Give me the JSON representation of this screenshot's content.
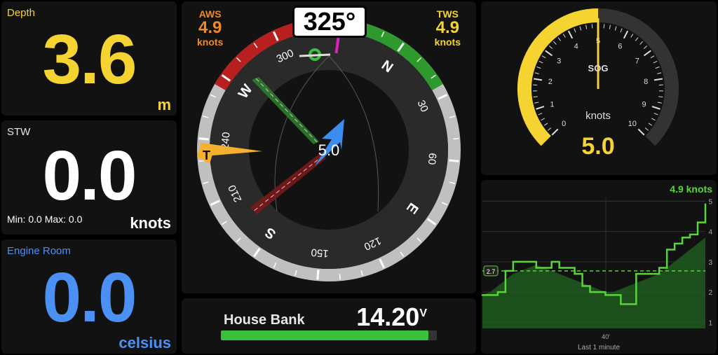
{
  "depth": {
    "title": "Depth",
    "value": "3.6",
    "unit": "m",
    "color": "#f5d331"
  },
  "stw": {
    "title": "STW",
    "value": "0.0",
    "unit": "knots",
    "minmax": "Min: 0.0 Max: 0.0",
    "color": "#ffffff"
  },
  "engine": {
    "title": "Engine Room",
    "value": "0.0",
    "unit": "celsius",
    "color": "#4a90f5"
  },
  "wind": {
    "heading": "325°",
    "aws_label": "AWS",
    "aws_value": "4.9",
    "aws_unit": "knots",
    "tws_label": "TWS",
    "tws_value": "4.9",
    "tws_unit": "knots",
    "center_value": "5.0",
    "cardinals": [
      "N",
      "E",
      "S",
      "W"
    ],
    "degree_labels": [
      "30",
      "60",
      "120",
      "150",
      "210",
      "240",
      "300"
    ],
    "true_wind_marker": "T",
    "colors": {
      "aws": "#f08a24",
      "tws": "#f5d331",
      "port": "#b82020",
      "starboard": "#2e9a2e",
      "boat": "#3d8df0"
    }
  },
  "sog": {
    "label": "SOG",
    "unit": "knots",
    "value": "5.0",
    "scale": [
      "0",
      "1",
      "2",
      "3",
      "4",
      "5",
      "6",
      "7",
      "8",
      "9",
      "10"
    ],
    "fraction": 0.5,
    "color": "#f5d331"
  },
  "housebank": {
    "title": "House Bank",
    "value": "14.20",
    "unit": "V",
    "fraction": 0.96,
    "color": "#3bc03b"
  },
  "chart_data": {
    "type": "line",
    "title": "4.9 knots",
    "xlabel": "Last 1 minute",
    "x_tick": "40'",
    "y_ticks": [
      "1",
      "2",
      "3",
      "4",
      "5"
    ],
    "ylim": [
      0.8,
      5.1
    ],
    "reference_label": "2.7",
    "reference_value": 2.7,
    "series": [
      {
        "color": "#5ad43c",
        "values": [
          1.9,
          1.9,
          2.0,
          2.7,
          3.0,
          3.0,
          3.0,
          2.8,
          2.8,
          3.0,
          2.8,
          2.8,
          2.6,
          2.2,
          2.0,
          2.0,
          1.9,
          1.9,
          1.6,
          1.6,
          2.6,
          2.6,
          2.6,
          2.8,
          3.4,
          3.6,
          3.8,
          3.9,
          4.3,
          4.9
        ]
      },
      {
        "values": [
          1.9,
          2.0,
          2.2,
          2.4,
          2.6,
          2.7,
          2.8,
          2.9,
          2.8,
          2.7,
          2.6,
          2.5,
          2.4,
          2.3,
          2.2,
          2.1,
          2.0,
          2.0,
          2.1,
          2.2,
          2.3,
          2.4,
          2.5,
          2.6,
          2.8,
          3.0,
          3.2,
          3.4,
          3.6,
          3.8
        ]
      }
    ]
  }
}
